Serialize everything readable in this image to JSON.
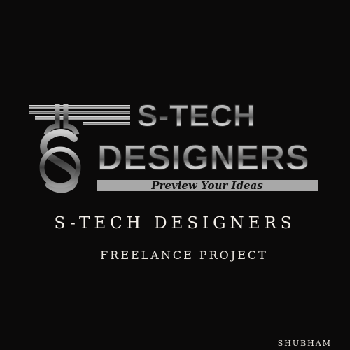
{
  "logo": {
    "line1": "S-TECH",
    "line2": "DESIGNERS",
    "tagline": "Preview Your Ideas"
  },
  "title": "S-TECH DESIGNERS",
  "subtitle": "FREELANCE PROJECT",
  "author": "SHUBHAM",
  "colors": {
    "background": "#0b0a0a",
    "text": "#f3efe9",
    "chrome": "#bdbdbd"
  }
}
